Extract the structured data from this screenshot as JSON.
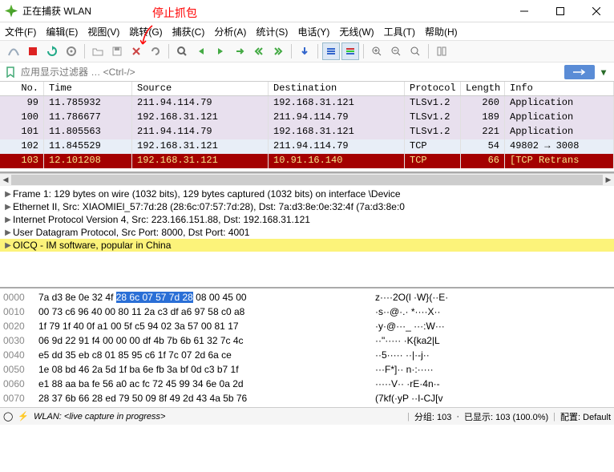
{
  "window": {
    "title": "正在捕获 WLAN"
  },
  "annotation_label": "停止抓包",
  "menu": {
    "file": "文件(F)",
    "edit": "编辑(E)",
    "view": "视图(V)",
    "go": "跳转(G)",
    "capture": "捕获(C)",
    "analyze": "分析(A)",
    "stats": "统计(S)",
    "telephony": "电话(Y)",
    "wireless": "无线(W)",
    "tools": "工具(T)",
    "help": "帮助(H)"
  },
  "filter": {
    "placeholder": "应用显示过滤器 … <Ctrl-/>"
  },
  "packet_list": {
    "headers": {
      "no": "No.",
      "time": "Time",
      "source": "Source",
      "destination": "Destination",
      "protocol": "Protocol",
      "length": "Length",
      "info": "Info"
    },
    "rows": [
      {
        "no": "99",
        "time": "11.785932",
        "src": "211.94.114.79",
        "dst": "192.168.31.121",
        "proto": "TLSv1.2",
        "len": "260",
        "info": "Application",
        "cls": "row-tls"
      },
      {
        "no": "100",
        "time": "11.786677",
        "src": "192.168.31.121",
        "dst": "211.94.114.79",
        "proto": "TLSv1.2",
        "len": "189",
        "info": "Application",
        "cls": "row-tls"
      },
      {
        "no": "101",
        "time": "11.805563",
        "src": "211.94.114.79",
        "dst": "192.168.31.121",
        "proto": "TLSv1.2",
        "len": "221",
        "info": "Application",
        "cls": "row-tls"
      },
      {
        "no": "102",
        "time": "11.845529",
        "src": "192.168.31.121",
        "dst": "211.94.114.79",
        "proto": "TCP",
        "len": "54",
        "info": "49802 → 3008",
        "cls": "row-tcp"
      },
      {
        "no": "103",
        "time": "12.101208",
        "src": "192.168.31.121",
        "dst": "10.91.16.140",
        "proto": "TCP",
        "len": "66",
        "info": "[TCP Retrans",
        "cls": "row-retrans"
      }
    ]
  },
  "details": {
    "frame": "Frame 1: 129 bytes on wire (1032 bits), 129 bytes captured (1032 bits) on interface \\Device",
    "eth": "Ethernet II, Src: XIAOMIEl_57:7d:28 (28:6c:07:57:7d:28), Dst: 7a:d3:8e:0e:32:4f (7a:d3:8e:0",
    "ip": "Internet Protocol Version 4, Src: 223.166.151.88, Dst: 192.168.31.121",
    "udp": "User Datagram Protocol, Src Port: 8000, Dst Port: 4001",
    "oicq": "OICQ - IM software, popular in China"
  },
  "hex": {
    "rows": [
      {
        "off": "0000",
        "b1": "7a d3 8e 0e 32 4f ",
        "sel": "28 6c  07 57 7d 28",
        "b2": " 08 00 45 00",
        "ascii": "z····2O(l ·W}(··E·"
      },
      {
        "off": "0010",
        "b1": "00 73 c6 96 40 00 80 11  2a c3 df a6 97 58 c0 a8",
        "sel": "",
        "b2": "",
        "ascii": "·s··@·.· *····X··"
      },
      {
        "off": "0020",
        "b1": "1f 79 1f 40 0f a1 00 5f  c5 94 02 3a 57 00 81 17",
        "sel": "",
        "b2": "",
        "ascii": "·y·@···_ ···:W···"
      },
      {
        "off": "0030",
        "b1": "06 9d 22 91 f4 00 00 00  df 4b 7b 6b 61 32 7c 4c",
        "sel": "",
        "b2": "",
        "ascii": "··\"····· ·K{ka2|L"
      },
      {
        "off": "0040",
        "b1": "e5 dd 35 eb c8 01 85 95  c6 1f 7c 07 2d 6a ce    ",
        "sel": "",
        "b2": "",
        "ascii": "··5····· ··|·-j··"
      },
      {
        "off": "0050",
        "b1": "1e 08 bd 46 2a 5d 1f ba  6e fb 3a bf 0d c3 b7 1f",
        "sel": "",
        "b2": "",
        "ascii": "···F*]·· n·:·····"
      },
      {
        "off": "0060",
        "b1": "e1 88 aa ba fe 56 a0 ac  fc 72 45 99 34 6e 0a 2d",
        "sel": "",
        "b2": "",
        "ascii": "·····V·· ·rE·4n·-"
      },
      {
        "off": "0070",
        "b1": "28 37 6b 66 28 ed 79 50  09 8f 49 2d 43 4a 5b 76",
        "sel": "",
        "b2": "",
        "ascii": "(7kf(·yP ··I-CJ[v"
      }
    ]
  },
  "status": {
    "iface": "WLAN: <live capture in progress>",
    "packets": "分组: 103",
    "displayed": "已显示: 103 (100.0%)",
    "profile": "配置: Default"
  }
}
